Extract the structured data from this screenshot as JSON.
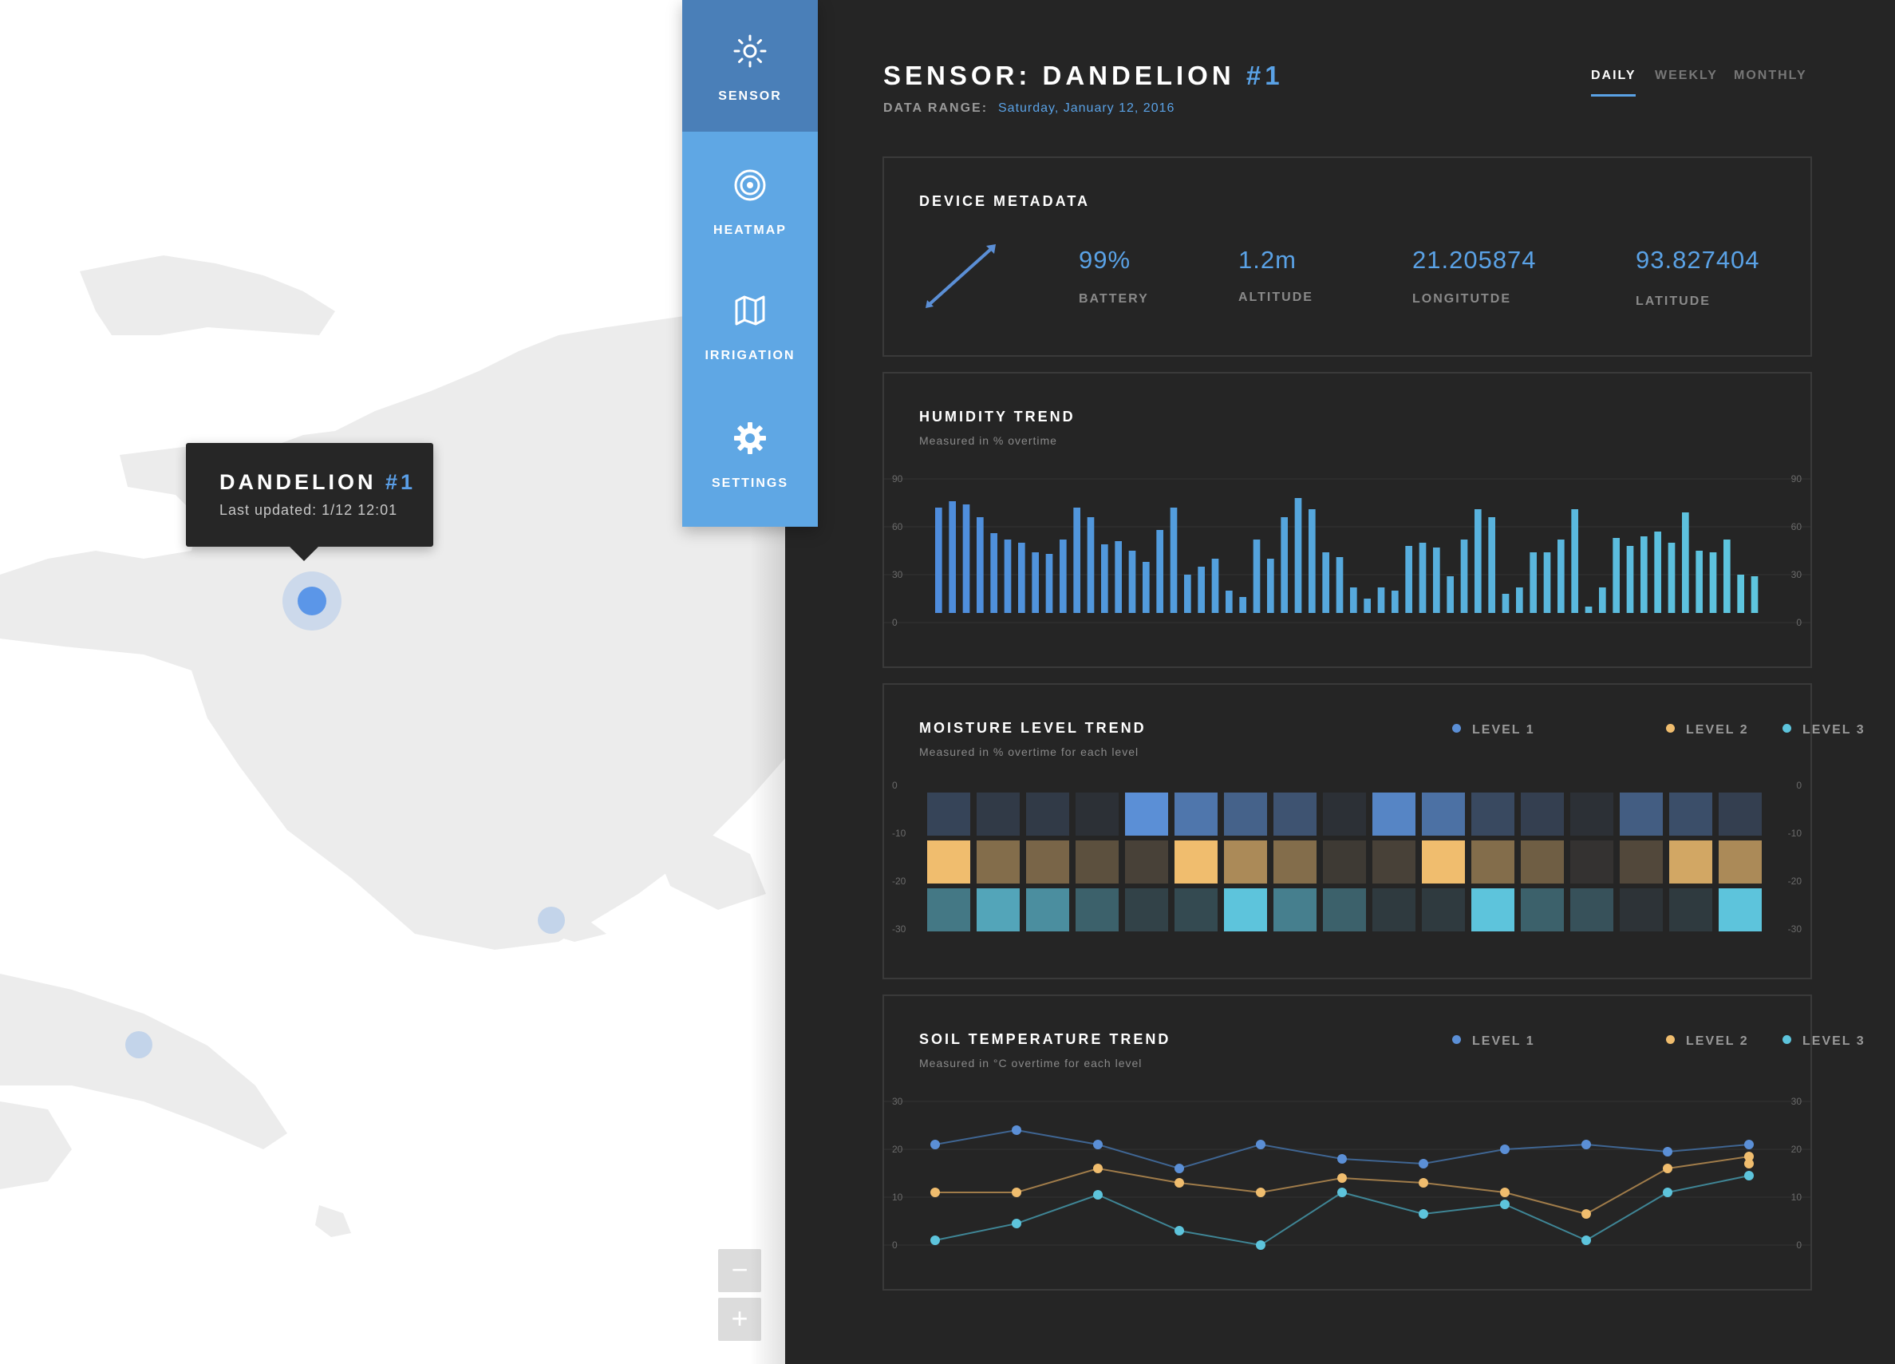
{
  "map": {
    "tooltip": {
      "title": "DANDELION",
      "title_accent": "#1",
      "subtitle": "Last updated: 1/12 12:01"
    },
    "zoom_out": "−",
    "zoom_in": "+"
  },
  "nav": {
    "items": [
      {
        "label": "SENSOR",
        "icon": "sun-icon",
        "active": true
      },
      {
        "label": "HEATMAP",
        "icon": "target-icon",
        "active": false
      },
      {
        "label": "IRRIGATION",
        "icon": "map-icon",
        "active": false
      },
      {
        "label": "SETTINGS",
        "icon": "gear-icon",
        "active": false
      }
    ]
  },
  "header": {
    "title": "SENSOR: DANDELION",
    "title_accent": "#1",
    "range_label": "DATA RANGE:",
    "range_value": "Saturday, January 12, 2016",
    "tabs": [
      {
        "label": "DAILY",
        "active": true
      },
      {
        "label": "WEEKLY",
        "active": false
      },
      {
        "label": "MONTHLY",
        "active": false
      }
    ]
  },
  "metadata": {
    "title": "DEVICE METADATA",
    "icon": "pencil-arrow-icon",
    "items": [
      {
        "value": "99%",
        "label": "BATTERY"
      },
      {
        "value": "1.2m",
        "label": "ALTITUDE"
      },
      {
        "value": "21.205874",
        "label": "LONGITUTDE"
      },
      {
        "value": "93.827404",
        "label": "LATITUDE"
      }
    ]
  },
  "colors": {
    "accent": "#5aa2e6",
    "level1": "#5b8fd6",
    "level2": "#f0bd6e",
    "level3": "#5dc4dc",
    "panel_border": "#3a3a3a",
    "background": "#252525"
  },
  "chart_data": [
    {
      "type": "bar",
      "title": "HUMIDITY TREND",
      "subtitle": "Measured in % overtime",
      "ylim": [
        0,
        90
      ],
      "yticks": [
        "90",
        "60",
        "30",
        "0"
      ],
      "grid": true,
      "values": [
        72,
        76,
        74,
        66,
        56,
        52,
        50,
        44,
        43,
        52,
        72,
        66,
        49,
        51,
        45,
        38,
        58,
        72,
        30,
        35,
        40,
        20,
        16,
        52,
        40,
        66,
        78,
        71,
        44,
        41,
        22,
        15,
        22,
        20,
        48,
        50,
        47,
        29,
        52,
        71,
        66,
        18,
        22,
        44,
        44,
        52,
        71,
        10,
        22,
        53,
        48,
        54,
        57,
        50,
        69,
        45,
        44,
        52,
        30,
        29
      ]
    },
    {
      "type": "heatmap",
      "title": "MOISTURE LEVEL TREND",
      "subtitle": "Measured in % overtime for each level",
      "legend": [
        "LEVEL 1",
        "LEVEL 2",
        "LEVEL 3"
      ],
      "yticks": [
        "0",
        "-10",
        "-20",
        "-30"
      ],
      "rows": [
        [
          0.25,
          0.15,
          0.15,
          0.05,
          1.0,
          0.75,
          0.55,
          0.4,
          0.05,
          0.9,
          0.7,
          0.3,
          0.2,
          0.05,
          0.5,
          0.35,
          0.2
        ],
        [
          1.0,
          0.45,
          0.4,
          0.25,
          0.15,
          1.0,
          0.65,
          0.45,
          0.1,
          0.15,
          1.0,
          0.45,
          0.35,
          0.05,
          0.2,
          0.85,
          0.65
        ],
        [
          0.5,
          0.8,
          0.65,
          0.35,
          0.15,
          0.2,
          1.0,
          0.55,
          0.35,
          0.1,
          0.1,
          1.0,
          0.35,
          0.25,
          0.05,
          0.1,
          1.0
        ]
      ]
    },
    {
      "type": "line",
      "title": "SOIL TEMPERATURE TREND",
      "subtitle": "Measured in °C overtime for each level",
      "ylim": [
        0,
        30
      ],
      "yticks": [
        "30",
        "20",
        "10",
        "0"
      ],
      "grid": true,
      "series": [
        {
          "name": "LEVEL 1",
          "values": [
            21,
            24,
            21,
            16,
            21,
            18,
            17,
            20,
            21,
            19.5,
            21
          ]
        },
        {
          "name": "LEVEL 2",
          "values": [
            11,
            11,
            16,
            13,
            11,
            14,
            13,
            11,
            6.5,
            16,
            18.5,
            17
          ]
        },
        {
          "name": "LEVEL 3",
          "values": [
            1,
            4.5,
            10.5,
            3,
            0,
            11,
            6.5,
            8.5,
            1,
            11,
            14.5
          ]
        }
      ],
      "series_x": [
        [
          0,
          1,
          2,
          3,
          4,
          5,
          6,
          7,
          8,
          9,
          10
        ],
        [
          0,
          1,
          2,
          3,
          4,
          5,
          6,
          7,
          8,
          9,
          10,
          10
        ],
        [
          0,
          1,
          2,
          3,
          4,
          5,
          6,
          7,
          8,
          9,
          10
        ]
      ]
    }
  ]
}
